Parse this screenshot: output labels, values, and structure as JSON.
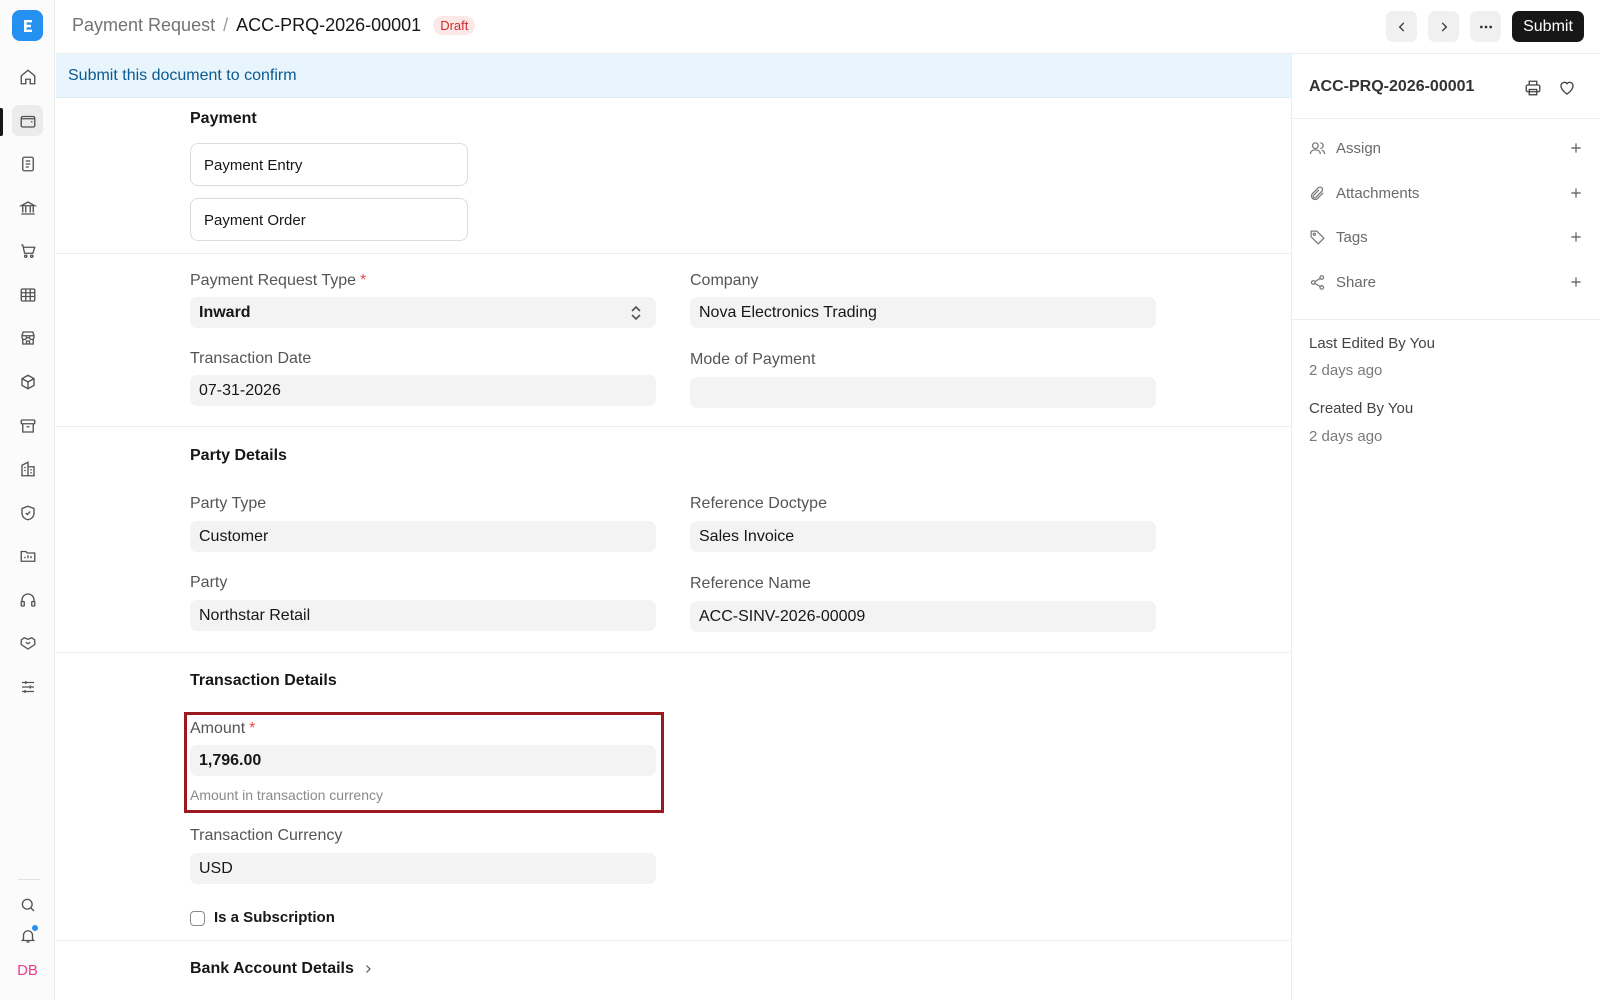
{
  "app": {
    "logo_letter": "E",
    "brand_color": "#2490ef"
  },
  "rail": {
    "icons": [
      "home-icon",
      "wallet-icon",
      "document-icon",
      "bank-icon",
      "cart-icon",
      "table-icon",
      "store-icon",
      "package-icon",
      "archive-icon",
      "building-icon",
      "shield-icon",
      "folder-icon",
      "headset-icon",
      "handshake-icon",
      "sliders-icon"
    ],
    "active_index": 1,
    "bottom_icons": [
      "search-icon",
      "bell-icon"
    ],
    "user_initials": "DB"
  },
  "header": {
    "breadcrumb_parent": "Payment Request",
    "separator": "/",
    "title": "ACC-PRQ-2026-00001",
    "status_badge": "Draft",
    "submit_label": "Submit"
  },
  "banner": {
    "text": "Submit this document to confirm"
  },
  "payment_section": {
    "title": "Payment",
    "links": [
      "Payment Entry",
      "Payment Order"
    ]
  },
  "form": {
    "payment_request_type": {
      "label": "Payment Request Type",
      "required": "*",
      "value": "Inward"
    },
    "company": {
      "label": "Company",
      "value": "Nova Electronics Trading"
    },
    "transaction_date": {
      "label": "Transaction Date",
      "value": "07-31-2026"
    },
    "mode_of_payment": {
      "label": "Mode of Payment",
      "value": ""
    }
  },
  "party_details": {
    "title": "Party Details",
    "party_type": {
      "label": "Party Type",
      "value": "Customer"
    },
    "reference_doctype": {
      "label": "Reference Doctype",
      "value": "Sales Invoice"
    },
    "party": {
      "label": "Party",
      "value": "Northstar Retail"
    },
    "reference_name": {
      "label": "Reference Name",
      "value": "ACC-SINV-2026-00009"
    }
  },
  "transaction_details": {
    "title": "Transaction Details",
    "amount": {
      "label": "Amount",
      "required": "*",
      "value": "1,796.00",
      "help": "Amount in transaction currency"
    },
    "transaction_currency": {
      "label": "Transaction Currency",
      "value": "USD"
    },
    "is_subscription": {
      "label": "Is a Subscription",
      "checked": false
    }
  },
  "bank_account_details": {
    "title": "Bank Account Details"
  },
  "sidebar": {
    "doc_name": "ACC-PRQ-2026-00001",
    "actions": [
      {
        "label": "Assign",
        "icon": "user-icon"
      },
      {
        "label": "Attachments",
        "icon": "paperclip-icon"
      },
      {
        "label": "Tags",
        "icon": "tag-icon"
      },
      {
        "label": "Share",
        "icon": "share-icon"
      }
    ],
    "last_edited_label": "Last Edited By You",
    "last_edited_time": "2 days ago",
    "created_label": "Created By You",
    "created_time": "2 days ago"
  }
}
